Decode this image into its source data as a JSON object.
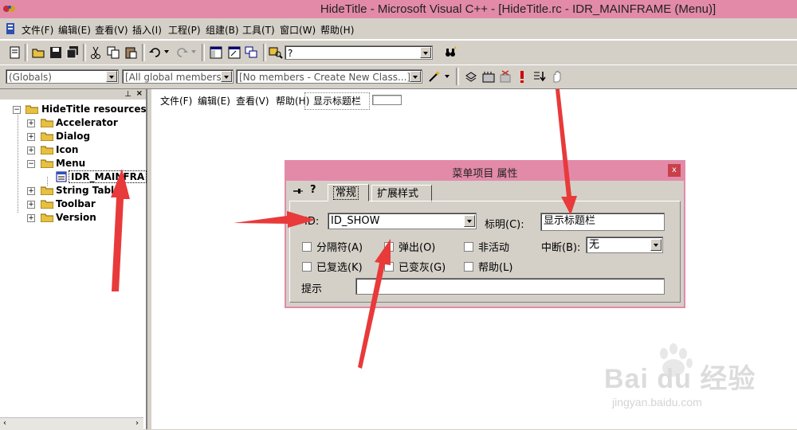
{
  "window": {
    "title": "HideTitle - Microsoft Visual C++ - [HideTitle.rc - IDR_MAINFRAME (Menu)]"
  },
  "menubar": [
    "文件(F)",
    "编辑(E)",
    "查看(V)",
    "插入(I)",
    "工程(P)",
    "组建(B)",
    "工具(T)",
    "窗口(W)",
    "帮助(H)"
  ],
  "toolbar": {
    "find_combo": "?",
    "class_combo": "(Globals)",
    "filter_combo": "[All global members",
    "members_combo": "[No members - Create New Class...]"
  },
  "tree": {
    "root": "HideTitle resources",
    "items": [
      "Accelerator",
      "Dialog",
      "Icon",
      "Menu",
      "String Table",
      "Toolbar",
      "Version"
    ],
    "menu_child": "IDR_MAINFRA"
  },
  "editor_menu": [
    "文件(F)",
    "编辑(E)",
    "查看(V)",
    "帮助(H)",
    "显示标题栏"
  ],
  "dialog": {
    "title": "菜单项目 属性",
    "close": "x",
    "tabs": [
      "常规",
      "扩展样式"
    ],
    "id_label": "ID:",
    "id_value": "ID_SHOW",
    "caption_label": "标明(C):",
    "caption_value": "显示标题栏",
    "checkboxes": [
      "分隔符(A)",
      "弹出(O)",
      "非活动",
      "已复选(K)",
      "已变灰(G)",
      "帮助(L)"
    ],
    "break_label": "中断(B):",
    "break_value": "无",
    "prompt_label": "提示",
    "prompt_value": ""
  },
  "watermark": {
    "brand": "Bai du 经验",
    "url": "jingyan.baidu.com"
  },
  "colors": {
    "title_bar": "#e38aa9",
    "annotation_arrow": "#e83a3a",
    "window_bg": "#d4d0c8"
  }
}
